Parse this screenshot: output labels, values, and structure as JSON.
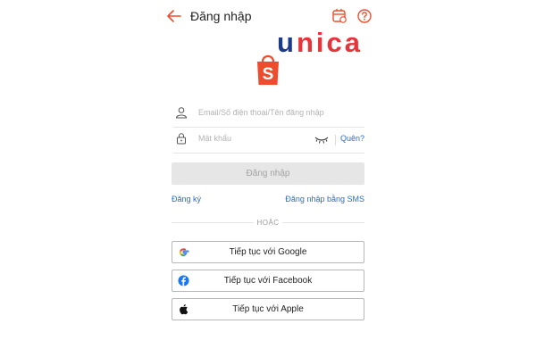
{
  "header": {
    "title": "Đăng nhập",
    "accent_color": "#ee4d2d"
  },
  "watermark": {
    "text": "unica",
    "first_letter": "u",
    "rest": "nica"
  },
  "logo": {
    "letter": "S",
    "color": "#ee4d2d"
  },
  "form": {
    "username_placeholder": "Email/Số điện thoại/Tên đăng nhập",
    "password_placeholder": "Mật khẩu",
    "forgot_label": "Quên?",
    "login_button": "Đăng nhập"
  },
  "links": {
    "register": "Đăng ký",
    "sms_login": "Đăng nhập bằng SMS"
  },
  "divider": {
    "or_text": "HOẶC"
  },
  "social": [
    {
      "label": "Tiếp tục với Google",
      "icon": "google-icon"
    },
    {
      "label": "Tiếp tục với Facebook",
      "icon": "facebook-icon"
    },
    {
      "label": "Tiếp tục với Apple",
      "icon": "apple-icon"
    }
  ]
}
